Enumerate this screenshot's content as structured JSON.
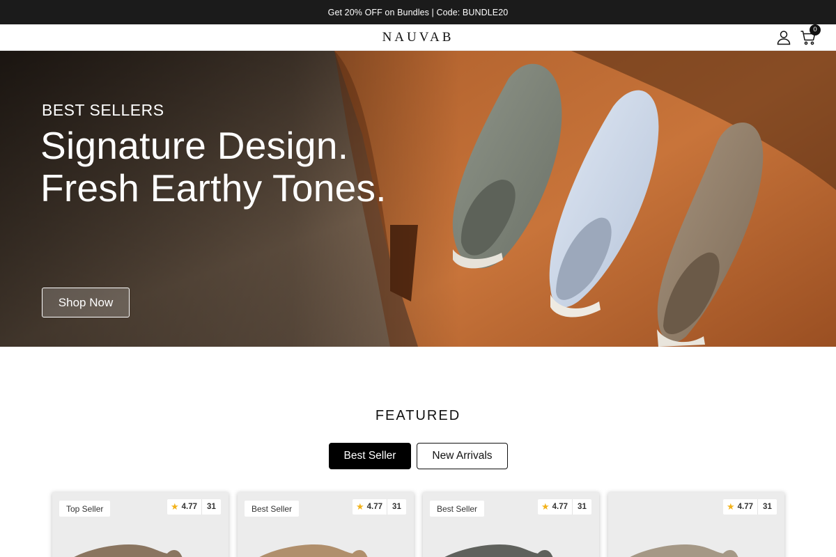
{
  "announcement": "Get 20% OFF on Bundles | Code: BUNDLE20",
  "header": {
    "logo": "NAUVAB",
    "cart_count": "0",
    "icons": {
      "account": "user-icon",
      "cart": "cart-icon"
    }
  },
  "hero": {
    "eyebrow": "BEST SELLERS",
    "headline_line1": "Signature Design.",
    "headline_line2": "Fresh Earthy Tones.",
    "cta": "Shop Now"
  },
  "featured": {
    "title": "FEATURED",
    "tabs": [
      {
        "label": "Best Seller",
        "active": true
      },
      {
        "label": "New Arrivals",
        "active": false
      }
    ],
    "products": [
      {
        "badge": "Top Seller",
        "rating": "4.77",
        "reviews": "31"
      },
      {
        "badge": "Best Seller",
        "rating": "4.77",
        "reviews": "31"
      },
      {
        "badge": "Best Seller",
        "rating": "4.77",
        "reviews": "31"
      },
      {
        "badge": "",
        "rating": "4.77",
        "reviews": "31"
      }
    ]
  },
  "colors": {
    "announcement_bg": "#1b1b1b",
    "star": "#f2b21a",
    "active_tab": "#000000"
  }
}
